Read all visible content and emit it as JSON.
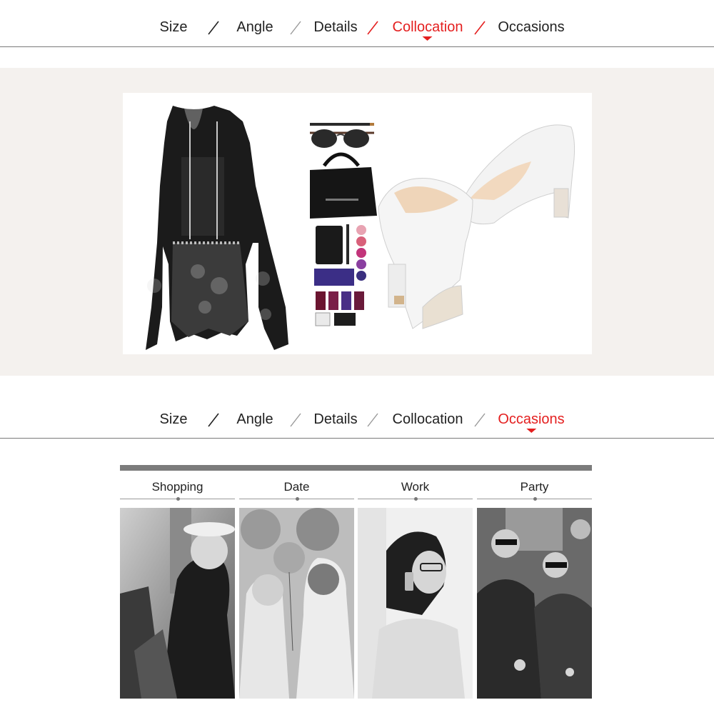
{
  "nav_top": {
    "items": [
      {
        "label": "Size"
      },
      {
        "label": "Angle"
      },
      {
        "label": "Details"
      },
      {
        "label": "Collocation"
      },
      {
        "label": "Occasions"
      }
    ],
    "active": "Collocation"
  },
  "nav_occasions": {
    "items": [
      {
        "label": "Size"
      },
      {
        "label": "Angle"
      },
      {
        "label": "Details"
      },
      {
        "label": "Collocation"
      },
      {
        "label": "Occasions"
      }
    ],
    "active": "Occasions"
  },
  "collocation": {
    "items": [
      "lace-blouse-image",
      "pencil-icon",
      "sunglasses-image",
      "handbag-image",
      "nail-polish-set-image",
      "peep-toe-heels-image"
    ]
  },
  "occasions": [
    {
      "label": "Shopping",
      "photo": "shopping-photo"
    },
    {
      "label": "Date",
      "photo": "date-photo"
    },
    {
      "label": "Work",
      "photo": "work-photo"
    },
    {
      "label": "Party",
      "photo": "party-photo"
    }
  ],
  "colors": {
    "accent": "#e41f1f",
    "band_background": "#f4f1ee",
    "rule": "#7a7a7a",
    "occasion_bar": "#7c7c7c"
  }
}
